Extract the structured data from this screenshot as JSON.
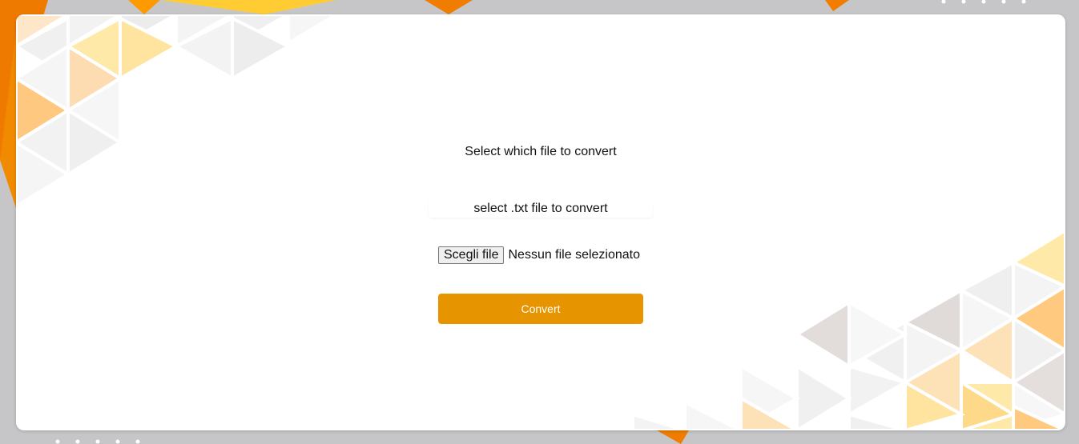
{
  "form": {
    "heading": "Select which file to convert",
    "file_label": "select .txt file to convert",
    "choose_button_label": "Scegli file",
    "no_file_text": "Nessun file selezionato",
    "convert_button_label": "Convert"
  },
  "colors": {
    "accent": "#e69500",
    "card_background": "#ffffff",
    "page_background": "#c9c9cb",
    "deco_orange": "#f07d00",
    "deco_yellow": "#ffd94d"
  }
}
